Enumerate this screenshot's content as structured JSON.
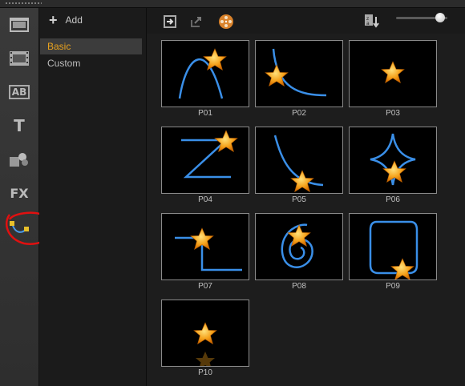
{
  "sidebar_icons": [
    {
      "name": "media-icon"
    },
    {
      "name": "filmstrip-icon"
    },
    {
      "name": "title-ab-icon",
      "text": "AB"
    },
    {
      "name": "text-icon",
      "text": "T"
    },
    {
      "name": "graphics-icon"
    },
    {
      "name": "fx-icon",
      "text": "FX"
    },
    {
      "name": "path-motion-icon"
    }
  ],
  "category_panel": {
    "add_label": "Add",
    "categories": [
      "Basic",
      "Custom"
    ],
    "selected": "Basic"
  },
  "toolbar": {
    "icons": [
      "import-icon",
      "export-icon",
      "film-reel-icon",
      "sort-icon"
    ],
    "thumbnail_size_slider": 1.0
  },
  "thumbnails": [
    {
      "label": "P01",
      "path": "arch"
    },
    {
      "label": "P02",
      "path": "curve-down"
    },
    {
      "label": "P03",
      "path": "none"
    },
    {
      "label": "P04",
      "path": "z-shape"
    },
    {
      "label": "P05",
      "path": "swoop"
    },
    {
      "label": "P06",
      "path": "four-point-star"
    },
    {
      "label": "P07",
      "path": "l-shape"
    },
    {
      "label": "P08",
      "path": "spiral"
    },
    {
      "label": "P09",
      "path": "loop"
    },
    {
      "label": "P10",
      "path": "none"
    }
  ],
  "colors": {
    "selected_category_text": "#e8a21e",
    "path_line": "#3a8fe8",
    "star": "#f5a21b",
    "annotation_circle": "#e01010"
  }
}
